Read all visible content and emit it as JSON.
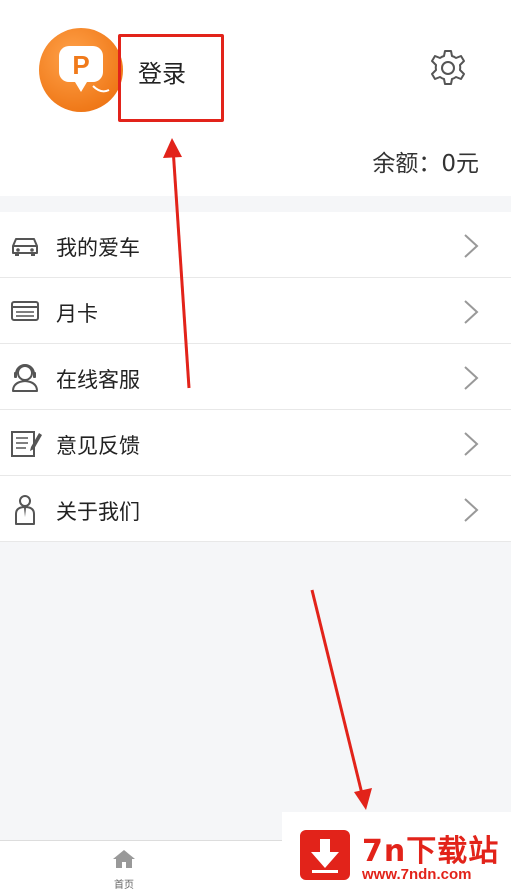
{
  "header": {
    "login_label": "登录",
    "balance_text": "余额：0元"
  },
  "menu": {
    "items": [
      {
        "label": "我的爱车",
        "icon": "car-icon"
      },
      {
        "label": "月卡",
        "icon": "card-icon"
      },
      {
        "label": "在线客服",
        "icon": "customer-service-icon"
      },
      {
        "label": "意见反馈",
        "icon": "feedback-icon"
      },
      {
        "label": "关于我们",
        "icon": "about-icon"
      }
    ]
  },
  "tabbar": {
    "home_label": "首页"
  },
  "watermark": {
    "title": "7n下载站",
    "url": "www.7ndn.com"
  },
  "colors": {
    "accent_orange": "#f07a1a",
    "annotation_red": "#e2231a"
  }
}
